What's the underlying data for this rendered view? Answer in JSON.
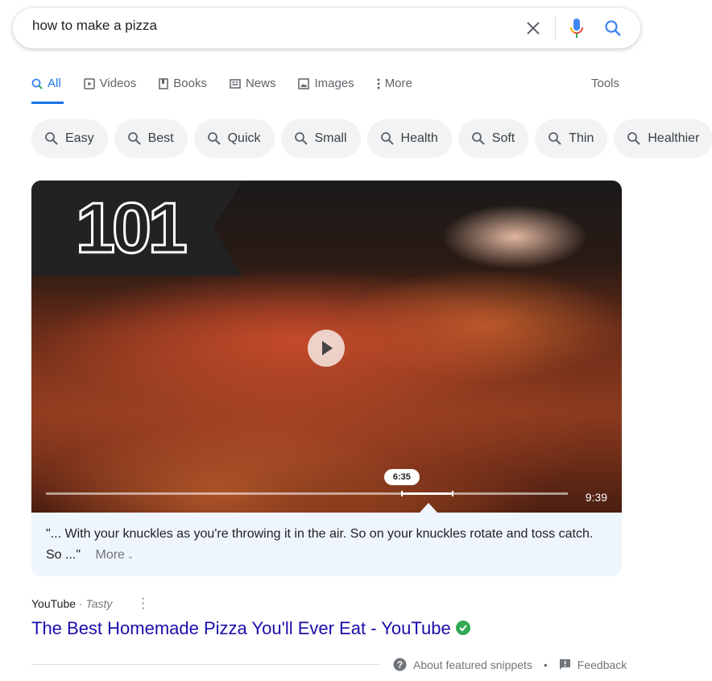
{
  "search": {
    "query": "how to make a pizza"
  },
  "tabs": [
    {
      "label": "All",
      "icon": "search-icon",
      "active": true
    },
    {
      "label": "Videos",
      "icon": "video-icon"
    },
    {
      "label": "Books",
      "icon": "book-icon"
    },
    {
      "label": "News",
      "icon": "news-icon"
    },
    {
      "label": "Images",
      "icon": "image-icon"
    },
    {
      "label": "More",
      "icon": "more-vert-icon"
    }
  ],
  "tools_label": "Tools",
  "chips": [
    "Easy",
    "Best",
    "Quick",
    "Small",
    "Health",
    "Soft",
    "Thin",
    "Healthier"
  ],
  "video": {
    "thumbnail_text": "101",
    "current_time": "6:35",
    "duration": "9:39",
    "progress_fraction": 0.682,
    "segment_end_fraction": 0.78
  },
  "snippet": {
    "text": "\"... With your knuckles as you're throwing it in the air. So on your knuckles rotate and toss catch. So ...\"",
    "more_label": "More"
  },
  "result": {
    "source": "YouTube",
    "channel": "Tasty",
    "title": "The Best Homemade Pizza You'll Ever Eat - YouTube",
    "title_color": "#1a0dab",
    "verified_color": "#34a853"
  },
  "footer": {
    "about": "About featured snippets",
    "feedback": "Feedback"
  }
}
